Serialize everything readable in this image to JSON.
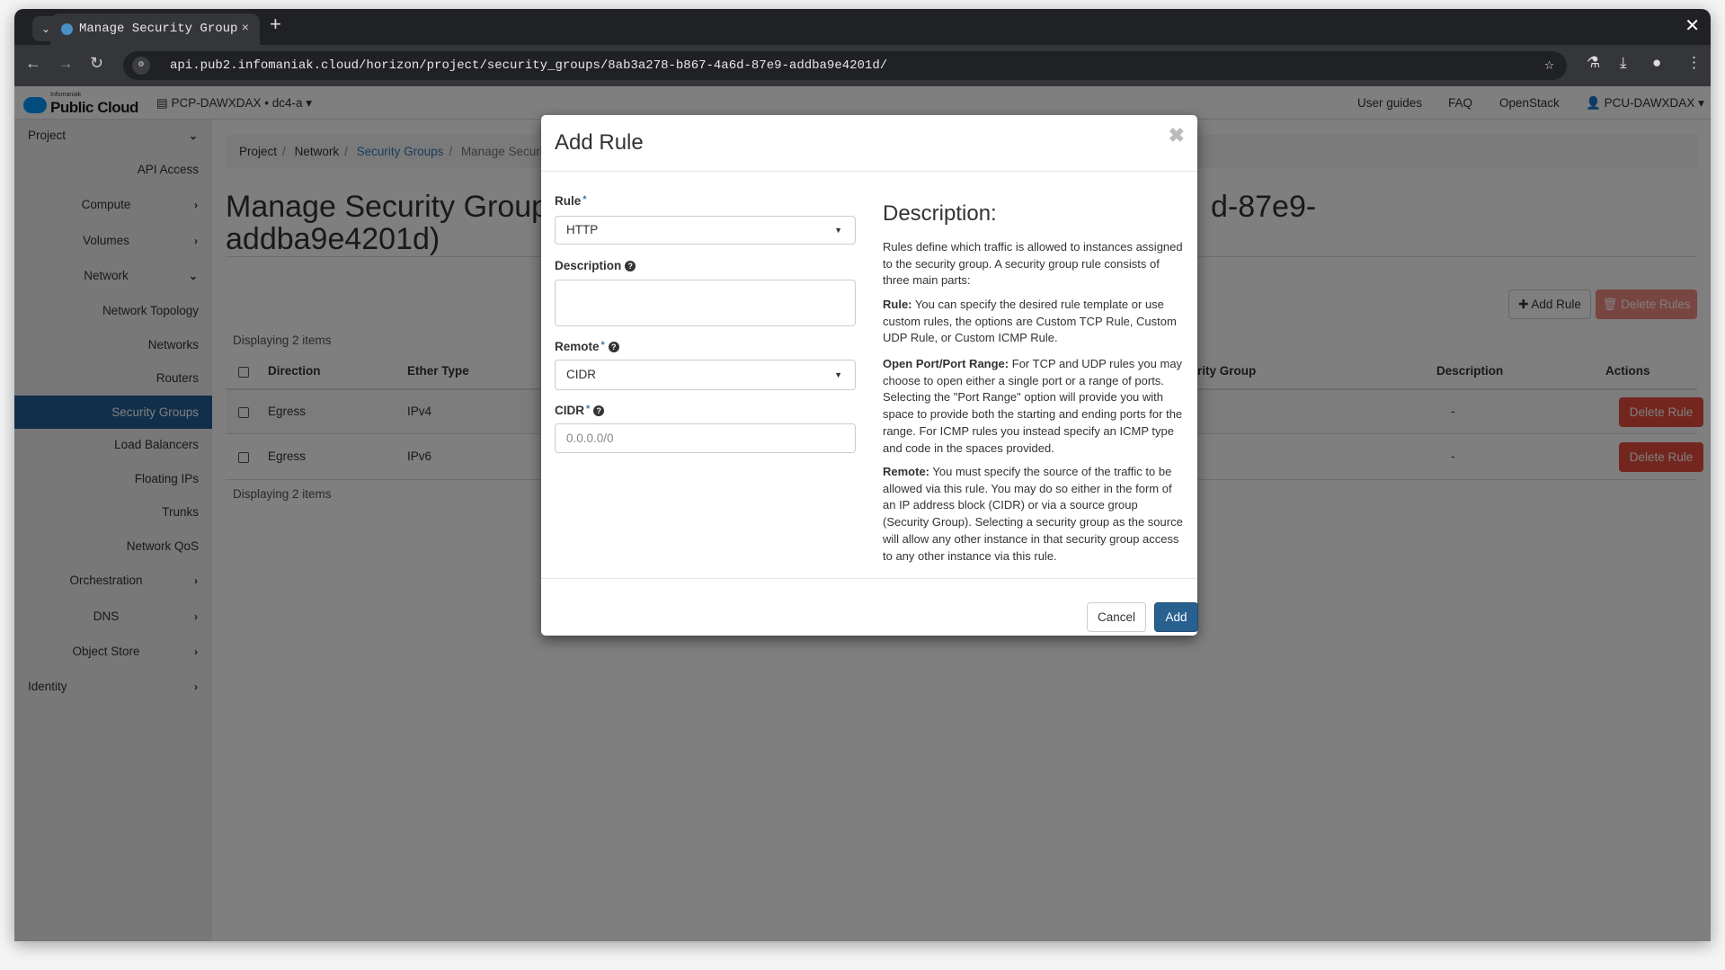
{
  "browser": {
    "tab_title": "Manage Security Group",
    "url": "api.pub2.infomaniak.cloud/horizon/project/security_groups/8ab3a278-b867-4a6d-87e9-addba9e4201d/"
  },
  "header": {
    "brand_small": "Infomaniak",
    "brand": "Public Cloud",
    "project": "PCP-DAWXDAX • dc4-a",
    "links": [
      "User guides",
      "FAQ",
      "OpenStack"
    ],
    "user": "PCU-DAWXDAX"
  },
  "sidebar": {
    "items": [
      {
        "label": "Project",
        "chevron": "down"
      },
      {
        "label": "API Access"
      },
      {
        "label": "Compute",
        "chevron": "right"
      },
      {
        "label": "Volumes",
        "chevron": "right"
      },
      {
        "label": "Network",
        "chevron": "down"
      },
      {
        "label": "Network Topology"
      },
      {
        "label": "Networks"
      },
      {
        "label": "Routers"
      },
      {
        "label": "Security Groups",
        "active": true
      },
      {
        "label": "Load Balancers"
      },
      {
        "label": "Floating IPs"
      },
      {
        "label": "Trunks"
      },
      {
        "label": "Network QoS"
      },
      {
        "label": "Orchestration",
        "chevron": "right"
      },
      {
        "label": "DNS",
        "chevron": "right"
      },
      {
        "label": "Object Store",
        "chevron": "right"
      },
      {
        "label": "Identity",
        "chevron": "right"
      }
    ]
  },
  "breadcrumb": [
    "Project",
    "Network",
    "Security Groups",
    "Manage Security"
  ],
  "page": {
    "title_line1_left": "Manage Security Group",
    "title_line1_right": "d-87e9-",
    "title_line2": "addba9e4201d)",
    "add_rule": "Add Rule",
    "delete_rules": "Delete Rules",
    "displaying": "Displaying 2 items"
  },
  "table": {
    "headers": {
      "direction": "Direction",
      "ether_type": "Ether Type",
      "remote_group": "rity Group",
      "description": "Description",
      "actions": "Actions"
    },
    "rows": [
      {
        "direction": "Egress",
        "ether_type": "IPv4",
        "description": "-",
        "action": "Delete Rule"
      },
      {
        "direction": "Egress",
        "ether_type": "IPv6",
        "description": "-",
        "action": "Delete Rule"
      }
    ]
  },
  "modal": {
    "title": "Add Rule",
    "rule_label": "Rule",
    "rule_value": "HTTP",
    "description_label": "Description",
    "description_value": "",
    "remote_label": "Remote",
    "remote_value": "CIDR",
    "cidr_label": "CIDR",
    "cidr_placeholder": "0.0.0.0/0",
    "help_heading": "Description:",
    "help_intro": "Rules define which traffic is allowed to instances assigned to the security group. A security group rule consists of three main parts:",
    "help_rule_title": "Rule:",
    "help_rule": "You can specify the desired rule template or use custom rules, the options are Custom TCP Rule, Custom UDP Rule, or Custom ICMP Rule.",
    "help_port_title": "Open Port/Port Range:",
    "help_port": "For TCP and UDP rules you may choose to open either a single port or a range of ports. Selecting the \"Port Range\" option will provide you with space to provide both the starting and ending ports for the range. For ICMP rules you instead specify an ICMP type and code in the spaces provided.",
    "help_remote_title": "Remote:",
    "help_remote": "You must specify the source of the traffic to be allowed via this rule. You may do so either in the form of an IP address block (CIDR) or via a source group (Security Group). Selecting a security group as the source will allow any other instance in that security group access to any other instance via this rule.",
    "cancel": "Cancel",
    "add": "Add"
  },
  "colors": {
    "primary": "#286090",
    "danger": "#e74c3c",
    "active_nav": "#235f95",
    "link": "#337ab7"
  }
}
